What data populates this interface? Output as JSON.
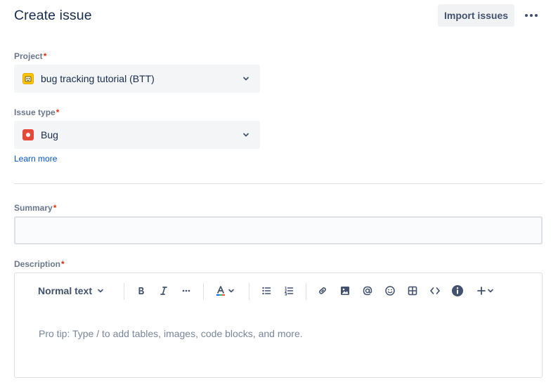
{
  "header": {
    "title": "Create issue",
    "import_label": "Import issues",
    "more_icon": "more-horizontal-icon"
  },
  "project": {
    "label": "Project",
    "required_mark": "*",
    "value": "bug tracking tutorial (BTT)",
    "icon": "project-avatar-icon"
  },
  "issue_type": {
    "label": "Issue type",
    "required_mark": "*",
    "value": "Bug",
    "icon": "bug-icon",
    "icon_color": "#e5493a",
    "learn_more": "Learn more"
  },
  "summary": {
    "label": "Summary",
    "required_mark": "*",
    "value": ""
  },
  "description": {
    "label": "Description",
    "required_mark": "*",
    "text_style": "Normal text",
    "placeholder": "Pro tip: Type / to add tables, images, code blocks, and more.",
    "toolbar_icons": [
      "bold-icon",
      "italic-icon",
      "more-formatting-icon",
      "text-color-icon",
      "bullet-list-icon",
      "numbered-list-icon",
      "link-icon",
      "image-icon",
      "mention-icon",
      "emoji-icon",
      "table-icon",
      "code-icon",
      "info-icon",
      "insert-plus-icon"
    ]
  },
  "colors": {
    "required": "#de350b",
    "link": "#0052cc",
    "text": "#172b4d"
  }
}
